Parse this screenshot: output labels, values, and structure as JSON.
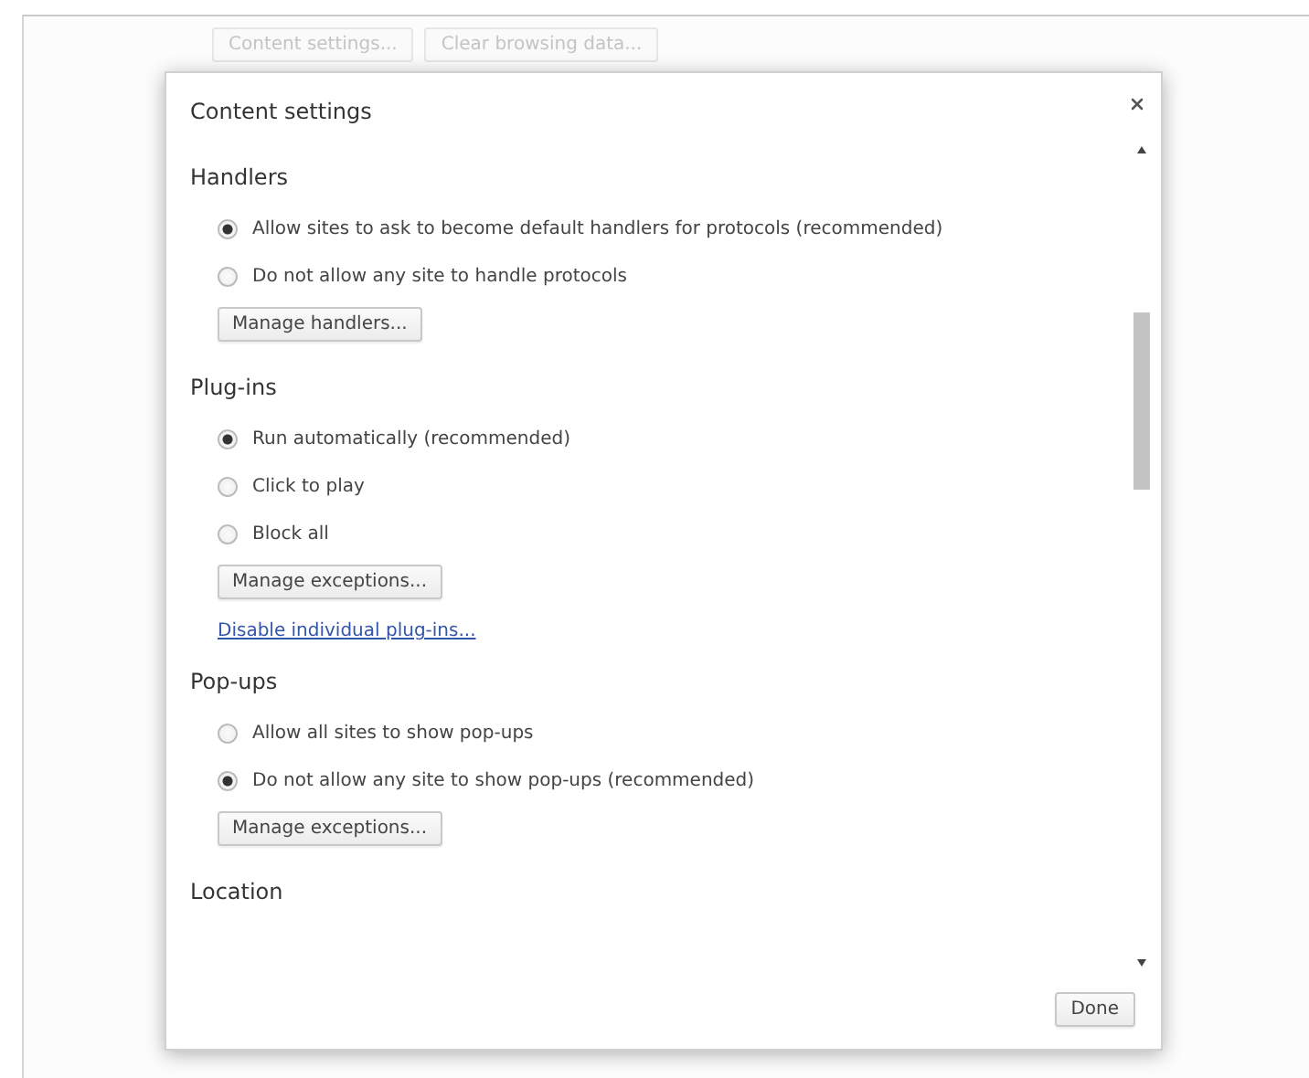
{
  "background_buttons": [
    "Content settings...",
    "Clear browsing data..."
  ],
  "dialog": {
    "title": "Content settings",
    "sections": [
      {
        "heading": "Handlers",
        "options": [
          {
            "label": "Allow sites to ask to become default handlers for protocols (recommended)",
            "selected": true
          },
          {
            "label": "Do not allow any site to handle protocols",
            "selected": false
          }
        ],
        "button": "Manage handlers..."
      },
      {
        "heading": "Plug-ins",
        "options": [
          {
            "label": "Run automatically (recommended)",
            "selected": true
          },
          {
            "label": "Click to play",
            "selected": false
          },
          {
            "label": "Block all",
            "selected": false
          }
        ],
        "button": "Manage exceptions...",
        "link": "Disable individual plug-ins..."
      },
      {
        "heading": "Pop-ups",
        "options": [
          {
            "label": "Allow all sites to show pop-ups",
            "selected": false
          },
          {
            "label": "Do not allow any site to show pop-ups (recommended)",
            "selected": true
          }
        ],
        "button": "Manage exceptions..."
      },
      {
        "heading": "Location"
      }
    ],
    "done_button": "Done"
  }
}
